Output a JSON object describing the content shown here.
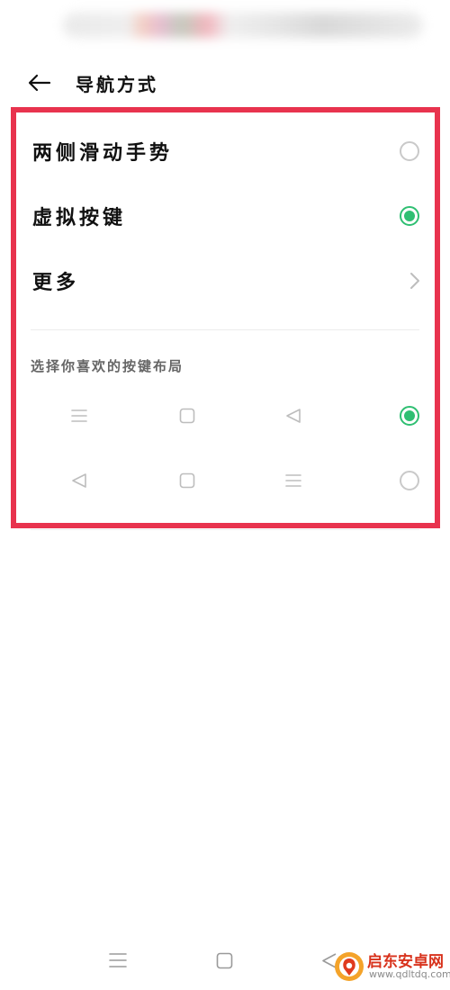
{
  "header": {
    "title": "导航方式"
  },
  "options": [
    {
      "label": "两侧滑动手势",
      "control": "radio",
      "selected": false
    },
    {
      "label": "虚拟按键",
      "control": "radio",
      "selected": true
    },
    {
      "label": "更多",
      "control": "chevron"
    }
  ],
  "layout_section": {
    "title": "选择你喜欢的按键布局",
    "layouts": [
      {
        "keys": [
          "menu",
          "home",
          "back"
        ],
        "selected": true
      },
      {
        "keys": [
          "back",
          "home",
          "menu"
        ],
        "selected": false
      }
    ]
  },
  "navbar": {
    "keys": [
      "menu",
      "home",
      "back"
    ]
  },
  "watermark": {
    "title": "启东安卓网",
    "url": "www.qdltdq.com"
  },
  "colors": {
    "accent": "#2fbf72",
    "highlight_border": "#e8334e",
    "watermark_red": "#d8321c"
  }
}
